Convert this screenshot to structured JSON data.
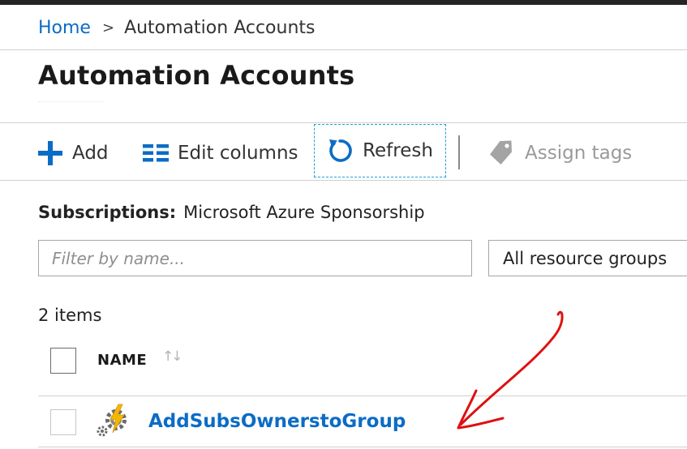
{
  "breadcrumb": {
    "home": "Home",
    "separator": ">",
    "current": "Automation Accounts"
  },
  "page": {
    "title": "Automation Accounts"
  },
  "toolbar": {
    "add_label": "Add",
    "edit_columns_label": "Edit columns",
    "refresh_label": "Refresh",
    "assign_tags_label": "Assign tags"
  },
  "subscriptions": {
    "label": "Subscriptions:",
    "value": "Microsoft Azure Sponsorship"
  },
  "filter": {
    "placeholder": "Filter by name...",
    "value": ""
  },
  "resource_groups": {
    "selected": "All resource groups"
  },
  "list": {
    "count_text": "2 items",
    "columns": [
      {
        "label": "NAME"
      }
    ],
    "rows": [
      {
        "name": "AddSubsOwnerstoGroup",
        "icon": "automation-account-icon"
      }
    ]
  },
  "colors": {
    "link": "#0b6cc6",
    "focus_border": "#1ea0dc",
    "disabled_text": "#9a9a9a",
    "annotation_arrow": "#e01010",
    "top_bar": "#252525"
  },
  "icons": {
    "add": "plus-icon",
    "edit_columns": "columns-icon",
    "refresh": "refresh-icon",
    "assign_tags": "tag-icon",
    "sort": "sort-icon"
  }
}
